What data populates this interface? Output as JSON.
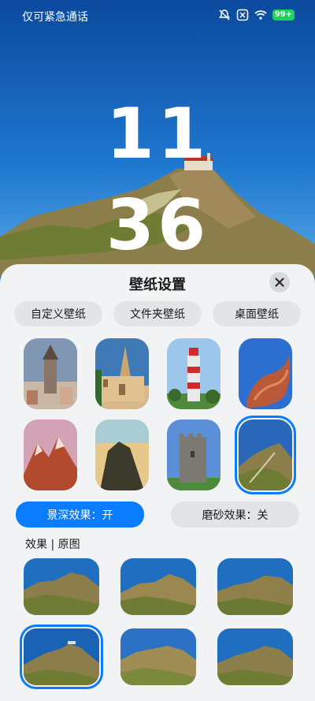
{
  "status_bar": {
    "carrier_text": "仅可紧急通话",
    "battery": "99+",
    "icons": [
      "bell-muted-icon",
      "close-box-icon",
      "wifi-icon",
      "battery-icon"
    ]
  },
  "clock": {
    "hours": "11",
    "minutes": "36"
  },
  "sheet": {
    "title": "壁纸设置",
    "close_icon": "close-icon",
    "types": [
      "自定义壁纸",
      "文件夹壁纸",
      "桌面壁纸"
    ],
    "wallpapers": [
      {
        "name": "galata-tower"
      },
      {
        "name": "castle-spire"
      },
      {
        "name": "lighthouse"
      },
      {
        "name": "red-rock"
      },
      {
        "name": "mountain-sunset"
      },
      {
        "name": "cliff-dusk"
      },
      {
        "name": "stone-tower"
      },
      {
        "name": "coastal-path",
        "selected": true
      }
    ],
    "depth_effect": "景深效果：开",
    "frost_effect": "磨砂效果：关",
    "effects_label": "效果 | 原图",
    "effect_variants": [
      {
        "name": "effect-1"
      },
      {
        "name": "effect-2"
      },
      {
        "name": "effect-3"
      },
      {
        "name": "effect-4",
        "selected": true
      },
      {
        "name": "effect-5"
      },
      {
        "name": "effect-6"
      }
    ]
  },
  "colors": {
    "accent": "#0a7cff",
    "sheet_bg": "#f2f3f5",
    "button_bg": "#e3e4e7",
    "battery": "#1bd35a"
  }
}
